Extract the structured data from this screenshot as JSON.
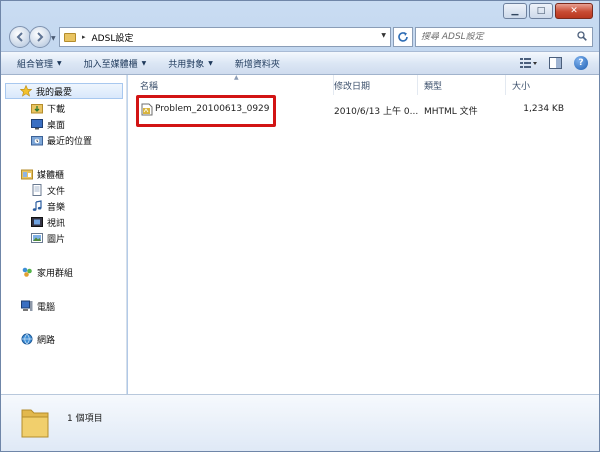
{
  "window": {
    "controls": {
      "minimize": "▁",
      "maximize": "□",
      "close": "✕"
    }
  },
  "address": {
    "separator": "▸",
    "path": "ADSL設定",
    "search_placeholder": "搜尋 ADSL設定"
  },
  "toolbar": {
    "organize": "組合管理",
    "include_in_library": "加入至媒體櫃",
    "share_with": "共用對象",
    "new_folder": "新增資料夾"
  },
  "nav_pane": {
    "favorites": {
      "label": "我的最愛",
      "items": [
        "下載",
        "桌面",
        "最近的位置"
      ]
    },
    "libraries": {
      "label": "媒體櫃",
      "items": [
        "文件",
        "音樂",
        "視訊",
        "圖片"
      ]
    },
    "homegroup": "家用群組",
    "computer": "電腦",
    "network": "網路"
  },
  "columns": {
    "name": "名稱",
    "date_modified": "修改日期",
    "type": "類型",
    "size": "大小"
  },
  "files": [
    {
      "name": "Problem_20100613_0929",
      "date_modified": "2010/6/13 上午 0...",
      "type": "MHTML 文件",
      "size": "1,234 KB"
    }
  ],
  "details_pane": {
    "item_count": "1 個項目"
  },
  "colors": {
    "highlight_box": "#d21414",
    "folder": "#e9c462",
    "toolbar_text": "#1e395b"
  }
}
